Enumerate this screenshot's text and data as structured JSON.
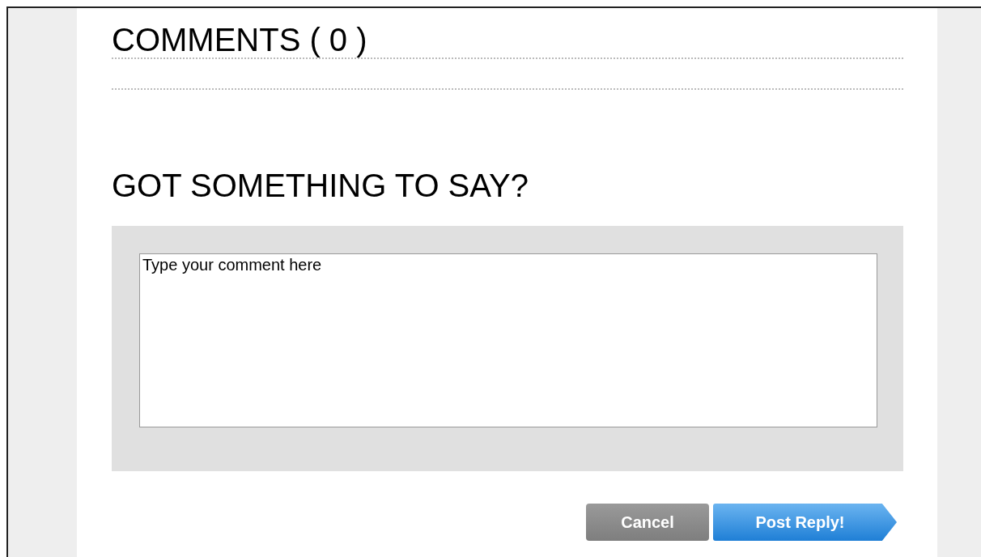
{
  "comments_heading": "COMMENTS ( 0 )",
  "form": {
    "heading": "GOT SOMETHING TO SAY?",
    "comment": {
      "value": "Type your comment here"
    },
    "buttons": [
      {
        "kind": "cancel",
        "label": "Cancel"
      },
      {
        "kind": "submit",
        "label": "Post Reply!"
      }
    ]
  }
}
